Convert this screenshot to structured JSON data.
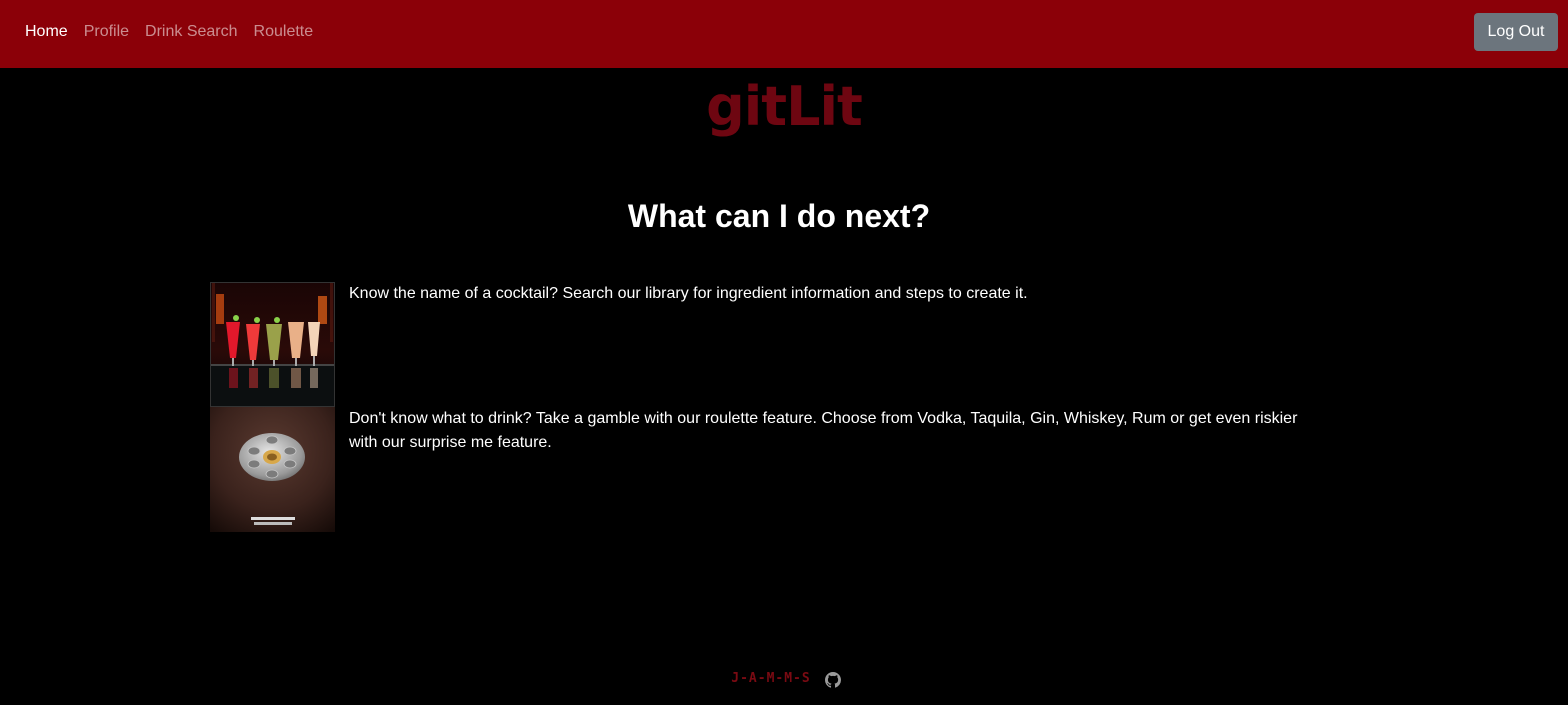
{
  "nav": {
    "items": [
      {
        "label": "Home",
        "active": true
      },
      {
        "label": "Profile",
        "active": false
      },
      {
        "label": "Drink Search",
        "active": false
      },
      {
        "label": "Roulette",
        "active": false
      }
    ],
    "logout_label": "Log Out"
  },
  "brand": {
    "title": "gitLit"
  },
  "main": {
    "heading": "What can I do next?",
    "features": [
      {
        "image_icon": "cocktail-glasses-image",
        "text": "Know the name of a cocktail? Search our library for ingredient information and steps to create it."
      },
      {
        "image_icon": "shot-roulette-image",
        "text": "Don't know what to drink? Take a gamble with our roulette feature. Choose from Vodka, Taquila, Gin, Whiskey, Rum or get even riskier with our surprise me feature."
      }
    ]
  },
  "footer": {
    "brand": "J-A-M-M-S",
    "github_icon": "github-icon"
  },
  "colors": {
    "navbar": "#8b0008",
    "brand": "#6e0611",
    "background": "#000000",
    "logout_button": "#6c757d"
  }
}
